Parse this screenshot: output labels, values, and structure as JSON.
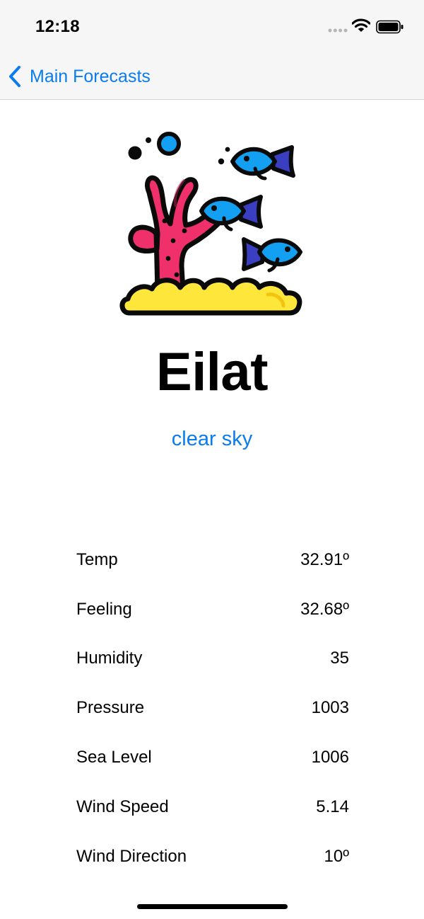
{
  "status_bar": {
    "time": "12:18"
  },
  "nav": {
    "back_label": "Main Forecasts"
  },
  "city": {
    "name": "Eilat",
    "condition": "clear sky"
  },
  "stats": [
    {
      "label": "Temp",
      "value": "32.91º"
    },
    {
      "label": "Feeling",
      "value": "32.68º"
    },
    {
      "label": "Humidity",
      "value": "35"
    },
    {
      "label": "Pressure",
      "value": "1003"
    },
    {
      "label": "Sea Level",
      "value": "1006"
    },
    {
      "label": "Wind Speed",
      "value": "5.14"
    },
    {
      "label": "Wind Direction",
      "value": "10º"
    }
  ],
  "colors": {
    "accent": "#0a7cf0",
    "coral": "#f0306b",
    "sand": "#ffe63a",
    "fish": "#139ff2"
  }
}
